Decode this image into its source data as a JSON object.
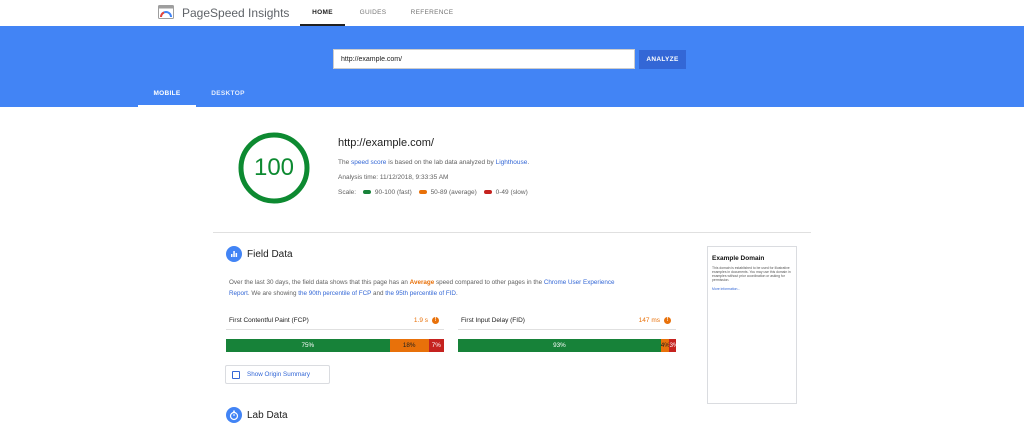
{
  "app": {
    "title": "PageSpeed Insights"
  },
  "nav": {
    "tabs": [
      {
        "label": "HOME"
      },
      {
        "label": "GUIDES"
      },
      {
        "label": "REFERENCE"
      }
    ]
  },
  "search": {
    "value": "http://example.com/",
    "analyze_label": "ANALYZE"
  },
  "device_tabs": [
    {
      "label": "MOBILE"
    },
    {
      "label": "DESKTOP"
    }
  ],
  "summary": {
    "score": "100",
    "score_fraction": 1.0,
    "url": "http://example.com/",
    "line1_a": "The ",
    "line1_link1": "speed score",
    "line1_b": " is based on the lab data analyzed by ",
    "line1_link2": "Lighthouse",
    "line1_c": ".",
    "analysis_time": "Analysis time: 11/12/2018, 9:33:35 AM",
    "scale_label": "Scale:",
    "scale": [
      {
        "label": "90-100 (fast)",
        "color": "#178239"
      },
      {
        "label": "50-89 (average)",
        "color": "#e8710a"
      },
      {
        "label": "0-49 (slow)",
        "color": "#c5221f"
      }
    ]
  },
  "field_data": {
    "title": "Field Data",
    "p1_a": "Over the last 30 days, the field data shows that this page has an ",
    "p1_avg": "Average",
    "p1_b": " speed compared to other pages in the ",
    "p1_link": "Chrome User Experience",
    "p2_link0": "Report",
    "p2_a": ". We are showing ",
    "p2_link1": "the 90th percentile of FCP",
    "p2_b": " and ",
    "p2_link2": "the 95th percentile of FID",
    "p2_c": ".",
    "metrics": [
      {
        "label": "First Contentful Paint (FCP)",
        "value": "1.9 s",
        "distribution": [
          {
            "pct": 75,
            "label": "75%"
          },
          {
            "pct": 18,
            "label": "18%"
          },
          {
            "pct": 7,
            "label": "7%"
          }
        ]
      },
      {
        "label": "First Input Delay (FID)",
        "value": "147 ms",
        "distribution": [
          {
            "pct": 93,
            "label": "93%"
          },
          {
            "pct": 4,
            "label": "4%"
          },
          {
            "pct": 3,
            "label": "3%"
          }
        ]
      }
    ],
    "origin_button": "Show Origin Summary"
  },
  "lab_data": {
    "title": "Lab Data"
  },
  "preview": {
    "title": "Example Domain",
    "text": "This domain is established to be used for illustrative examples in documents. You may use this domain in examples without prior coordination or asking for permission.",
    "link": "More information..."
  },
  "colors": {
    "brand_blue": "#4284f5",
    "fast": "#178239",
    "average": "#e8710a",
    "slow": "#c5221f"
  }
}
